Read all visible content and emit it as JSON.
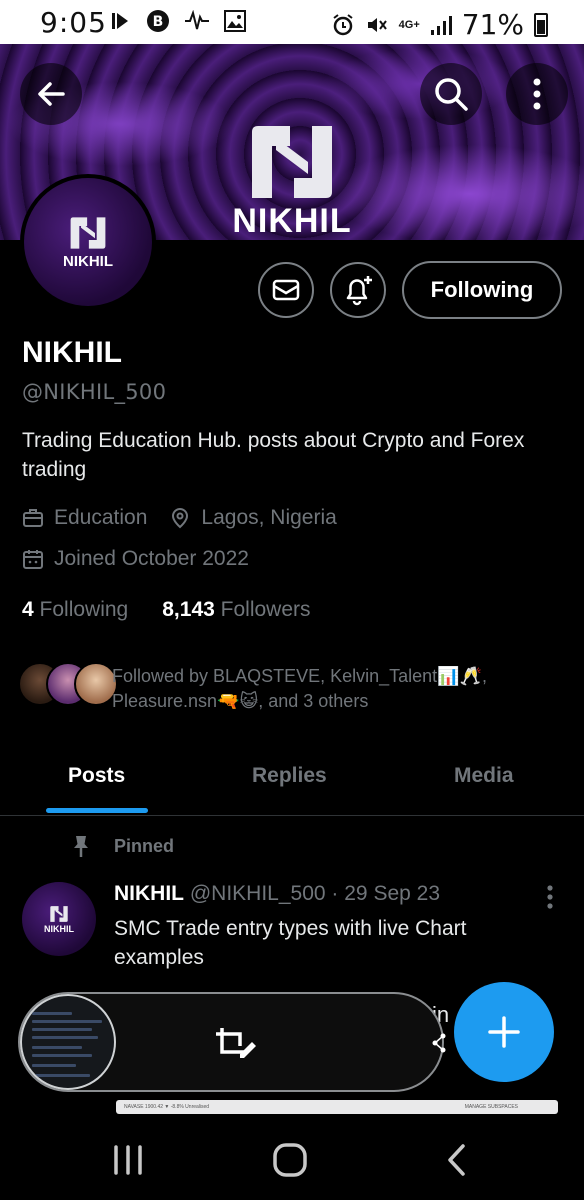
{
  "status_bar": {
    "time": "9:05",
    "network": "4G+",
    "battery": "71%"
  },
  "profile": {
    "banner_name": "NIKHIL",
    "avatar_text": "NIKHIL",
    "name": "NIKHIL",
    "handle": "@NIKHIL_500",
    "bio": "Trading Education Hub. posts about Crypto and Forex trading",
    "category": "Education",
    "location": "Lagos, Nigeria",
    "joined": "Joined October 2022",
    "following_count": "4",
    "following_label": "Following",
    "followers_count": "8,143",
    "followers_label": "Followers",
    "followed_by_line1": "Followed by BLAQSTEVE, Kelvin_Talent📊🥂,",
    "followed_by_line2": "Pleasure.nsn🔫😺, and 3 others"
  },
  "actions": {
    "following_button": "Following"
  },
  "tabs": [
    {
      "label": "Posts",
      "active": true
    },
    {
      "label": "Replies",
      "active": false
    },
    {
      "label": "Media",
      "active": false
    }
  ],
  "pinned_post": {
    "pinned_label": "Pinned",
    "avatar_text": "NIKHIL",
    "author": "NIKHIL",
    "handle": "@NIKHIL_500",
    "date": "· 29 Sep 23",
    "text": "SMC Trade entry types with live Chart examples",
    "overflow_text": "in"
  },
  "screenshot_toolbar": {
    "strip_left": "NAVASE 1900.42 ▼ -8.8% Unrealised",
    "strip_right": "MANAGE SUBSPACES"
  },
  "colors": {
    "accent": "#1d9bf0",
    "muted": "#71767b",
    "banner": "#4a1e7a"
  }
}
